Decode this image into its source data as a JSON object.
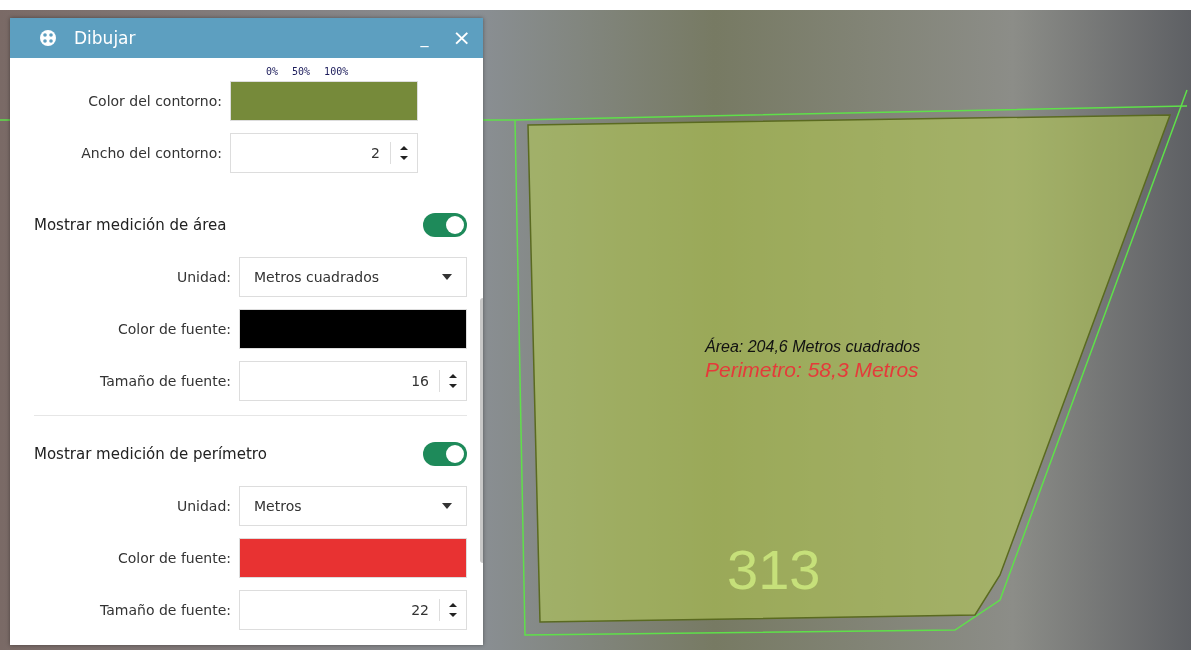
{
  "panel": {
    "title": "Dibujar",
    "minimize": "_",
    "close": "×"
  },
  "opacity_scale": [
    "0%",
    "50%",
    "100%"
  ],
  "sections": [
    {
      "rows": [
        {
          "kind": "color",
          "label": "Color del contorno:",
          "color": "#768a3a"
        },
        {
          "kind": "number",
          "label": "Ancho del contorno:",
          "value": "2"
        }
      ]
    },
    {
      "header": {
        "label": "Mostrar medición de área",
        "on": true
      },
      "rows": [
        {
          "kind": "select",
          "label": "Unidad:",
          "value": "Metros cuadrados"
        },
        {
          "kind": "color",
          "label": "Color de fuente:",
          "color": "#000000"
        },
        {
          "kind": "number",
          "label": "Tamaño de fuente:",
          "value": "16"
        }
      ]
    },
    {
      "header": {
        "label": "Mostrar medición de perímetro",
        "on": true
      },
      "rows": [
        {
          "kind": "select",
          "label": "Unidad:",
          "value": "Metros"
        },
        {
          "kind": "color",
          "label": "Color de fuente:",
          "color": "#e83232"
        },
        {
          "kind": "number",
          "label": "Tamaño de fuente:",
          "value": "22"
        }
      ]
    }
  ],
  "map": {
    "area_label": "Área: 204,6 Metros cuadrados",
    "perimeter_label": "Perimetro: 58,3 Metros",
    "parcel_number": "313"
  }
}
